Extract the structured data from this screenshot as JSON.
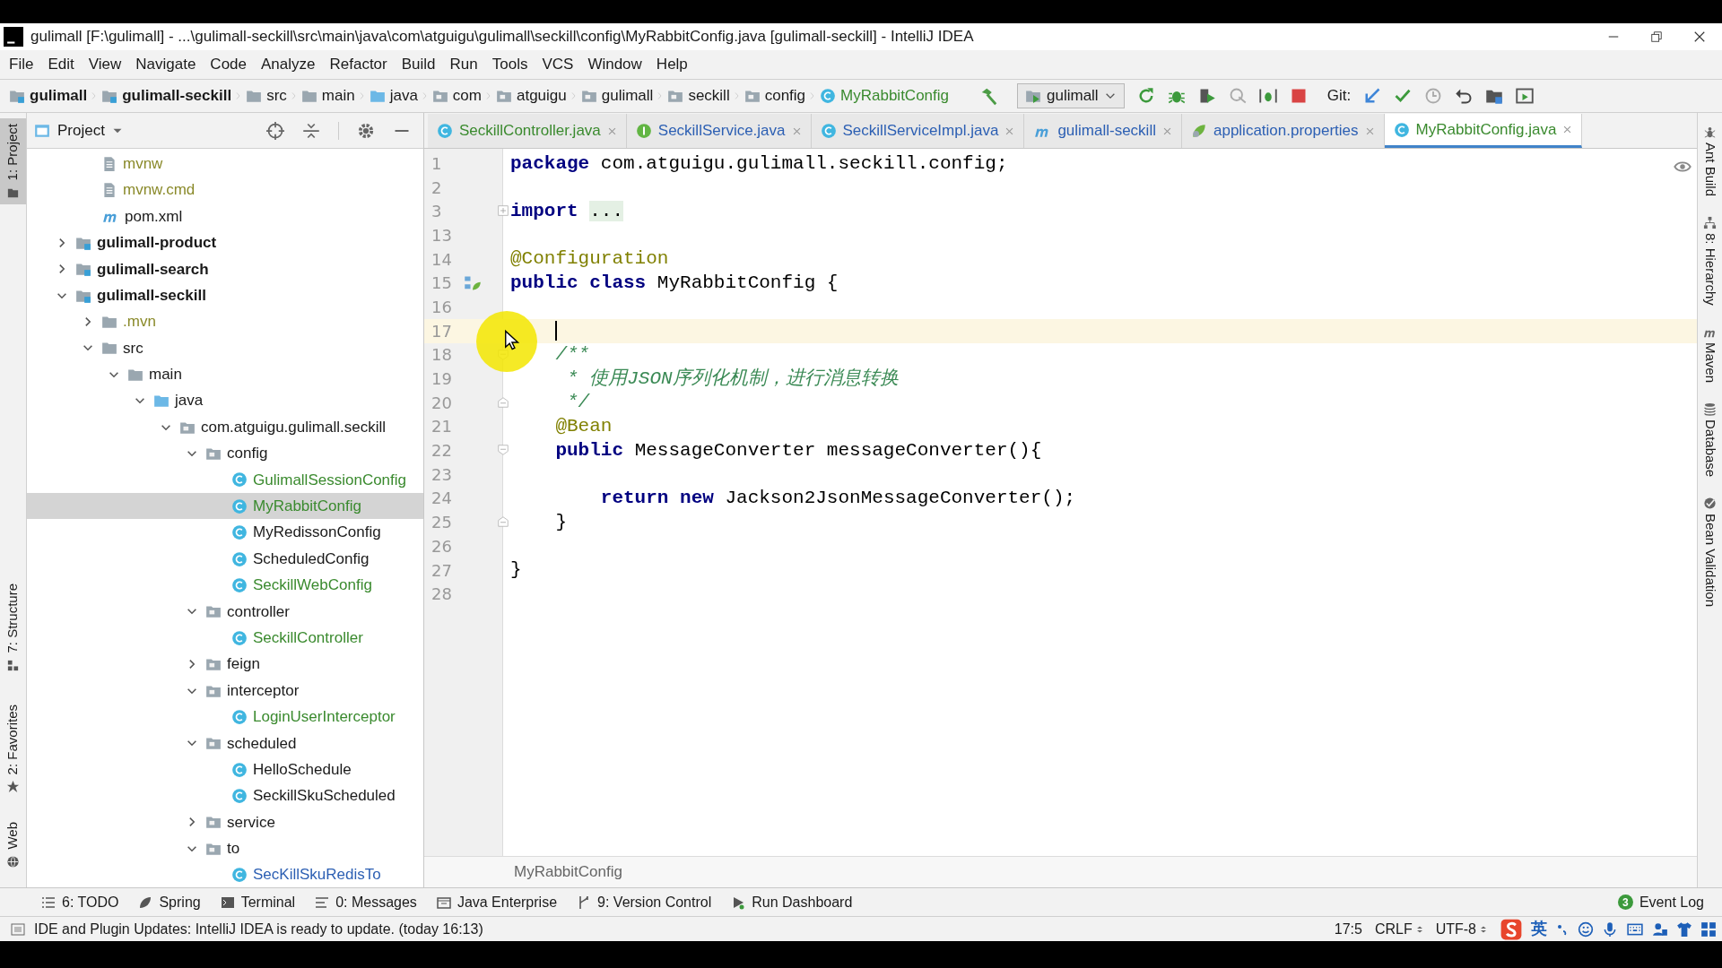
{
  "window": {
    "title": "gulimall [F:\\gulimall] - ...\\gulimall-seckill\\src\\main\\java\\com\\atguigu\\gulimall\\seckill\\config\\MyRabbitConfig.java [gulimall-seckill] - IntelliJ IDEA"
  },
  "menu": [
    "File",
    "Edit",
    "View",
    "Navigate",
    "Code",
    "Analyze",
    "Refactor",
    "Build",
    "Run",
    "Tools",
    "VCS",
    "Window",
    "Help"
  ],
  "breadcrumbs": [
    {
      "label": "gulimall",
      "kind": "module"
    },
    {
      "label": "gulimall-seckill",
      "kind": "module"
    },
    {
      "label": "src",
      "kind": "folder"
    },
    {
      "label": "main",
      "kind": "folder"
    },
    {
      "label": "java",
      "kind": "source-folder"
    },
    {
      "label": "com",
      "kind": "package"
    },
    {
      "label": "atguigu",
      "kind": "package"
    },
    {
      "label": "gulimall",
      "kind": "package"
    },
    {
      "label": "seckill",
      "kind": "package"
    },
    {
      "label": "config",
      "kind": "package"
    },
    {
      "label": "MyRabbitConfig",
      "kind": "class",
      "color": "#3a8a2e"
    }
  ],
  "run_config": "gulimall",
  "git_label": "Git:",
  "left_tools": [
    {
      "label": "1: Project",
      "kind": "project",
      "selected": true
    },
    {
      "label": "7: Structure",
      "kind": "structure",
      "selected": false
    },
    {
      "label": "2: Favorites",
      "kind": "favorites",
      "selected": false
    },
    {
      "label": "Web",
      "kind": "web",
      "selected": false
    }
  ],
  "right_tools": [
    {
      "label": "Ant Build",
      "kind": "ant",
      "selected": false
    },
    {
      "label": "8: Hierarchy",
      "kind": "hierarchy",
      "selected": false
    },
    {
      "label": "Maven",
      "kind": "maven",
      "selected": false
    },
    {
      "label": "Database",
      "kind": "database",
      "selected": false
    },
    {
      "label": "Bean Validation",
      "kind": "bean",
      "selected": false
    }
  ],
  "project_panel": {
    "title": "Project",
    "tree": [
      {
        "children": [
          {
            "label": "mvnw",
            "kind": "file",
            "color": "#8a8a2a",
            "selected": false
          },
          {
            "label": "mvnw.cmd",
            "kind": "file",
            "color": "#8a8a2a",
            "selected": false
          },
          {
            "label": "pom.xml",
            "kind": "maven",
            "selected": false
          }
        ]
      },
      {
        "label": "gulimall-product",
        "kind": "module",
        "expanded": false,
        "selected": false
      },
      {
        "label": "gulimall-search",
        "kind": "module",
        "expanded": false,
        "selected": false
      },
      {
        "label": "gulimall-seckill",
        "kind": "module",
        "expanded": true,
        "selected": false,
        "children": [
          {
            "label": ".mvn",
            "kind": "folder",
            "color": "#8a8a2a",
            "expanded": false,
            "selected": false
          },
          {
            "label": "src",
            "kind": "folder",
            "expanded": true,
            "selected": false,
            "children": [
              {
                "label": "main",
                "kind": "folder",
                "expanded": true,
                "selected": false,
                "children": [
                  {
                    "label": "java",
                    "kind": "source-folder",
                    "expanded": true,
                    "selected": false,
                    "children": [
                      {
                        "label": "com.atguigu.gulimall.seckill",
                        "kind": "package",
                        "expanded": true,
                        "selected": false,
                        "children": [
                          {
                            "label": "config",
                            "kind": "package",
                            "expanded": true,
                            "selected": false,
                            "children": [
                              {
                                "label": "GulimallSessionConfig",
                                "kind": "class",
                                "color": "#3a8a2e",
                                "selected": false
                              },
                              {
                                "label": "MyRabbitConfig",
                                "kind": "class",
                                "color": "#3a8a2e",
                                "selected": true
                              },
                              {
                                "label": "MyRedissonConfig",
                                "kind": "class",
                                "selected": false
                              },
                              {
                                "label": "ScheduledConfig",
                                "kind": "class",
                                "selected": false
                              },
                              {
                                "label": "SeckillWebConfig",
                                "kind": "class",
                                "color": "#3a8a2e",
                                "selected": false
                              }
                            ]
                          },
                          {
                            "label": "controller",
                            "kind": "package",
                            "expanded": true,
                            "selected": false,
                            "children": [
                              {
                                "label": "SeckillController",
                                "kind": "class",
                                "color": "#3a8a2e",
                                "selected": false
                              }
                            ]
                          },
                          {
                            "label": "feign",
                            "kind": "package",
                            "expanded": false,
                            "selected": false
                          },
                          {
                            "label": "interceptor",
                            "kind": "package",
                            "expanded": true,
                            "selected": false,
                            "children": [
                              {
                                "label": "LoginUserInterceptor",
                                "kind": "class",
                                "color": "#3a8a2e",
                                "selected": false
                              }
                            ]
                          },
                          {
                            "label": "scheduled",
                            "kind": "package",
                            "expanded": true,
                            "selected": false,
                            "children": [
                              {
                                "label": "HelloSchedule",
                                "kind": "class",
                                "selected": false
                              },
                              {
                                "label": "SeckillSkuScheduled",
                                "kind": "class",
                                "selected": false
                              }
                            ]
                          },
                          {
                            "label": "service",
                            "kind": "package",
                            "expanded": false,
                            "selected": false
                          },
                          {
                            "label": "to",
                            "kind": "package",
                            "expanded": true,
                            "selected": false,
                            "children": [
                              {
                                "label": "SecKillSkuRedisTo",
                                "kind": "class",
                                "color": "#2c5fb3",
                                "selected": false
                              }
                            ]
                          }
                        ]
                      }
                    ]
                  }
                ]
              }
            ]
          }
        ]
      }
    ]
  },
  "tabs": [
    {
      "label": "SeckillController.java",
      "kind": "class",
      "color": "#3a8a2e",
      "selected": false
    },
    {
      "label": "SeckillService.java",
      "kind": "interface",
      "color": "#2c5fb3",
      "selected": false
    },
    {
      "label": "SeckillServiceImpl.java",
      "kind": "class",
      "color": "#2c5fb3",
      "selected": false
    },
    {
      "label": "gulimall-seckill",
      "kind": "maven",
      "color": "#2c5fb3",
      "selected": false
    },
    {
      "label": "application.properties",
      "kind": "properties",
      "color": "#2c5fb3",
      "selected": false
    },
    {
      "label": "MyRabbitConfig.java",
      "kind": "class",
      "color": "#3a8a2e",
      "selected": true
    }
  ],
  "code": [
    {
      "number": "1",
      "tokens": [
        {
          "text": "package ",
          "kind": "keyword"
        },
        {
          "text": "com.atguigu.gulimall.seckill.config;",
          "kind": "plain"
        }
      ]
    },
    {
      "number": "2"
    },
    {
      "number": "3",
      "gutter": [
        {
          "kind": "fold_collapsed"
        }
      ],
      "tokens": [
        {
          "text": "import ",
          "kind": "keyword"
        },
        {
          "text": "...",
          "kind": "folded"
        }
      ]
    },
    {
      "number": "13"
    },
    {
      "number": "14",
      "tokens": [
        {
          "text": "@Configuration",
          "kind": "annotation"
        }
      ]
    },
    {
      "number": "15",
      "gutter": [
        {
          "kind": "bean"
        }
      ],
      "tokens": [
        {
          "text": "public class ",
          "kind": "keyword"
        },
        {
          "text": "MyRabbitConfig {",
          "kind": "plain"
        }
      ]
    },
    {
      "number": "16"
    },
    {
      "number": "17",
      "current": true
    },
    {
      "number": "18",
      "gutter": [
        {
          "kind": "fold_start"
        }
      ],
      "tokens": [
        {
          "text": "    /**",
          "kind": "comment"
        }
      ]
    },
    {
      "number": "19",
      "tokens": [
        {
          "text": "     * 使用JSON序列化机制，进行消息转换",
          "kind": "comment"
        }
      ]
    },
    {
      "number": "20",
      "gutter": [
        {
          "kind": "fold_end"
        }
      ],
      "tokens": [
        {
          "text": "     */",
          "kind": "comment"
        }
      ]
    },
    {
      "number": "21",
      "tokens": [
        {
          "text": "    @Bean",
          "kind": "annotation"
        }
      ]
    },
    {
      "number": "22",
      "gutter": [
        {
          "kind": "fold_start"
        }
      ],
      "tokens": [
        {
          "text": "    public ",
          "kind": "keyword"
        },
        {
          "text": "MessageConverter messageConverter(){",
          "kind": "plain"
        }
      ]
    },
    {
      "number": "23"
    },
    {
      "number": "24",
      "tokens": [
        {
          "text": "        return new ",
          "kind": "keyword"
        },
        {
          "text": "Jackson2JsonMessageConverter();",
          "kind": "plain"
        }
      ]
    },
    {
      "number": "25",
      "gutter": [
        {
          "kind": "fold_end"
        }
      ],
      "tokens": [
        {
          "text": "    }",
          "kind": "plain"
        }
      ]
    },
    {
      "number": "26"
    },
    {
      "number": "27",
      "tokens": [
        {
          "text": "}",
          "kind": "plain"
        }
      ]
    },
    {
      "number": "28"
    }
  ],
  "editor_breadcrumb": "MyRabbitConfig",
  "bottom_tools": [
    {
      "label": "6: TODO",
      "kind": "todo"
    },
    {
      "label": "Spring",
      "kind": "spring"
    },
    {
      "label": "Terminal",
      "kind": "terminal"
    },
    {
      "label": "0: Messages",
      "kind": "messages"
    },
    {
      "label": "Java Enterprise",
      "kind": "enterprise"
    },
    {
      "label": "9: Version Control",
      "kind": "vcs"
    },
    {
      "label": "Run Dashboard",
      "kind": "run"
    }
  ],
  "event_log": {
    "label": "Event Log",
    "count": "3"
  },
  "status_bar": {
    "message": "IDE and Plugin Updates: IntelliJ IDEA is ready to update. (today 16:13)",
    "position": "17:5",
    "line_separator": "CRLF",
    "encoding": "UTF-8",
    "ime_mode": "英"
  }
}
